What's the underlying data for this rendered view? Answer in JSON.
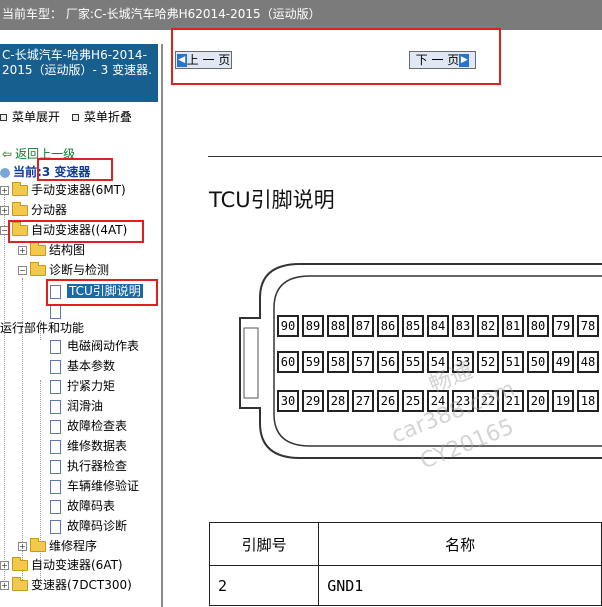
{
  "topbar": {
    "title": "当前车型：  厂家:C-长城汽车哈弗H62014-2015（运动版）"
  },
  "left": {
    "header": "C-长城汽车-哈弗H6-2014-2015（运动版）- 3 变速器.",
    "menu_expand": "菜单展开",
    "menu_collapse": "菜单折叠",
    "back": "返回上一级",
    "current_prefix": "当前:",
    "current": "3 变速器",
    "tree": {
      "mt": "手动变速器(6MT)",
      "transfer": "分动器",
      "at": "自动变速器((4AT)",
      "structure": "结构图",
      "diag": "诊断与检测",
      "tcu": "TCU引脚说明",
      "run": "运行部件和功能",
      "leaves": [
        "电磁阀动作表",
        "基本参数",
        "拧紧力矩",
        "润滑油",
        "故障检查表",
        "维修数据表",
        "执行器检查",
        "车辆维修验证",
        "故障码表",
        "故障码诊断"
      ],
      "repair": "维修程序",
      "at6": "自动变速器(6AT)",
      "dct": "变速器(7DCT300)"
    }
  },
  "nav": {
    "prev": "上 一 页",
    "next": "下 一 页"
  },
  "content": {
    "title": "TCU引脚说明",
    "pins_row1": [
      "90",
      "89",
      "88",
      "87",
      "86",
      "85",
      "84",
      "83",
      "82",
      "81",
      "80",
      "79",
      "78"
    ],
    "pins_row2": [
      "60",
      "59",
      "58",
      "57",
      "56",
      "55",
      "54",
      "53",
      "52",
      "51",
      "50",
      "49",
      "48"
    ],
    "pins_row3": [
      "30",
      "29",
      "28",
      "27",
      "26",
      "25",
      "24",
      "23",
      "22",
      "21",
      "20",
      "19",
      "18"
    ],
    "watermark1": "car388.com",
    "watermark2": "CY20165",
    "watermark3": "畅通",
    "table": {
      "col1": "引脚号",
      "col2": "名称",
      "rows": [
        {
          "pin": "2",
          "name": "GND1"
        }
      ]
    }
  }
}
